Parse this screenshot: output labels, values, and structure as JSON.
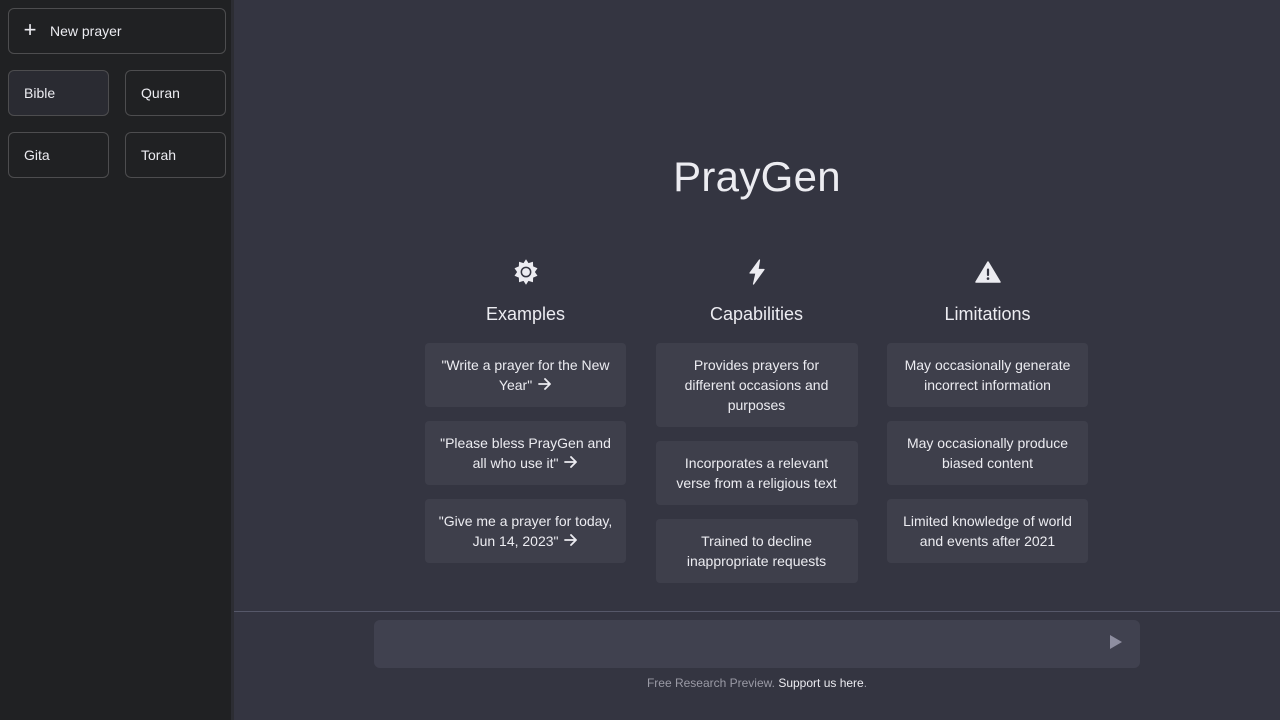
{
  "sidebar": {
    "new_button_icon": "+",
    "new_button_label": "New prayer",
    "books": [
      {
        "label": "Bible",
        "active": true
      },
      {
        "label": "Quran",
        "active": false
      },
      {
        "label": "Gita",
        "active": false
      },
      {
        "label": "Torah",
        "active": false
      }
    ]
  },
  "main": {
    "title": "PrayGen",
    "columns": [
      {
        "icon": "sun-icon",
        "title": "Examples",
        "items": [
          "\"Write a prayer for the New Year\"",
          "\"Please bless PrayGen and all who use it\"",
          "\"Give me a prayer for today, Jun 14, 2023\""
        ]
      },
      {
        "icon": "lightning-icon",
        "title": "Capabilities",
        "items": [
          "Provides prayers for different occasions and purposes",
          "Incorporates a relevant verse from a religious text",
          "Trained to decline inappropriate requests"
        ]
      },
      {
        "icon": "warning-icon",
        "title": "Limitations",
        "items": [
          "May occasionally generate incorrect information",
          "May occasionally produce biased content",
          "Limited knowledge of world and events after 2021"
        ]
      }
    ]
  },
  "input": {
    "value": "",
    "placeholder": ""
  },
  "footer": {
    "text": "Free Research Preview. ",
    "link_label": "Support us here",
    "suffix": "."
  },
  "colors": {
    "sidebar_bg": "#202123",
    "main_bg": "#343541",
    "card_bg": "#3e3f4b",
    "input_bg": "#40414f",
    "text": "#ececf1"
  }
}
